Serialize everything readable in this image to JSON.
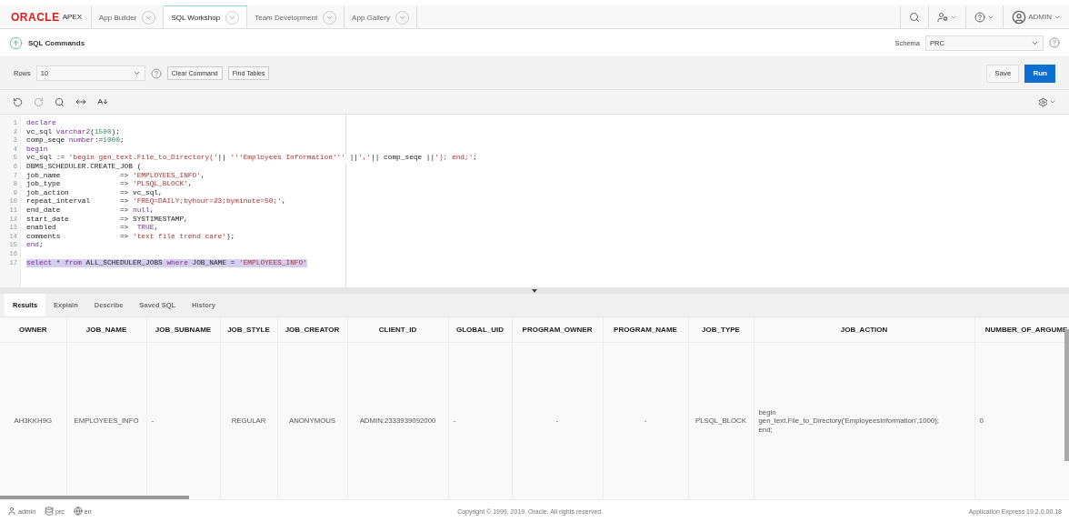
{
  "header": {
    "logo_brand": "ORACLE",
    "logo_product": "APEX",
    "user": "ADMIN",
    "tabs": [
      {
        "label": "App Builder",
        "selected": false
      },
      {
        "label": "SQL Workshop",
        "selected": true
      },
      {
        "label": "Team Development",
        "selected": false
      },
      {
        "label": "App Gallery",
        "selected": false
      }
    ]
  },
  "page": {
    "title": "SQL Commands",
    "schema_label": "Schema",
    "schema_value": "PRC"
  },
  "toolbar": {
    "rows_label": "Rows",
    "rows_value": "10",
    "buttons": [
      "Clear Command",
      "Find Tables"
    ],
    "save": "Save",
    "run": "Run"
  },
  "editor": {
    "lines": [
      {
        "number": "1",
        "selected": false,
        "tokens": [
          {
            "t": "declare",
            "kind": "kw"
          }
        ]
      },
      {
        "number": "2",
        "selected": false,
        "tokens": [
          {
            "t": "vc_sql ",
            "kind": "plain"
          },
          {
            "t": "varchar2",
            "kind": "kw"
          },
          {
            "t": "(",
            "kind": "plain"
          },
          {
            "t": "1500",
            "kind": "num"
          },
          {
            "t": ");",
            "kind": "plain"
          }
        ]
      },
      {
        "number": "3",
        "selected": false,
        "tokens": [
          {
            "t": "comp_seqe ",
            "kind": "plain"
          },
          {
            "t": "number",
            "kind": "kw"
          },
          {
            "t": ":=",
            "kind": "plain"
          },
          {
            "t": "1000",
            "kind": "num"
          },
          {
            "t": ";",
            "kind": "plain"
          }
        ]
      },
      {
        "number": "4",
        "selected": false,
        "tokens": [
          {
            "t": "begin",
            "kind": "kw"
          }
        ]
      },
      {
        "number": "5",
        "selected": false,
        "tokens": [
          {
            "t": "vc_sql := ",
            "kind": "plain"
          },
          {
            "t": "'begin gen_text.File_to_Directory('",
            "kind": "str"
          },
          {
            "t": "|| ",
            "kind": "plain"
          },
          {
            "t": "'''Employees Information'''",
            "kind": "str"
          },
          {
            "t": " ||",
            "kind": "plain"
          },
          {
            "t": "','",
            "kind": "str"
          },
          {
            "t": "|| comp_seqe ||",
            "kind": "plain"
          },
          {
            "t": "'); end;'",
            "kind": "str"
          },
          {
            "t": ";",
            "kind": "plain"
          }
        ]
      },
      {
        "number": "6",
        "selected": false,
        "tokens": [
          {
            "t": "DBMS_SCHEDULER.CREATE_JOB (",
            "kind": "plain"
          }
        ]
      },
      {
        "number": "7",
        "selected": false,
        "tokens": [
          {
            "t": "job_name              => ",
            "kind": "plain"
          },
          {
            "t": "'EMPLOYEES_INFO'",
            "kind": "str"
          },
          {
            "t": ",",
            "kind": "plain"
          }
        ]
      },
      {
        "number": "8",
        "selected": false,
        "tokens": [
          {
            "t": "job_type              => ",
            "kind": "plain"
          },
          {
            "t": "'PLSQL_BLOCK'",
            "kind": "str"
          },
          {
            "t": ",",
            "kind": "plain"
          }
        ]
      },
      {
        "number": "9",
        "selected": false,
        "tokens": [
          {
            "t": "job_action            => vc_sql,",
            "kind": "plain"
          }
        ]
      },
      {
        "number": "10",
        "selected": false,
        "tokens": [
          {
            "t": "repeat_interval       => ",
            "kind": "plain"
          },
          {
            "t": "'FREQ=DAILY;byhour=23;byminute=50;'",
            "kind": "str"
          },
          {
            "t": ",",
            "kind": "plain"
          }
        ]
      },
      {
        "number": "11",
        "selected": false,
        "tokens": [
          {
            "t": "end_date              => ",
            "kind": "plain"
          },
          {
            "t": "null",
            "kind": "kw"
          },
          {
            "t": ",",
            "kind": "plain"
          }
        ]
      },
      {
        "number": "12",
        "selected": false,
        "tokens": [
          {
            "t": "start_date            => SYSTIMESTAMP,",
            "kind": "plain"
          }
        ]
      },
      {
        "number": "13",
        "selected": false,
        "tokens": [
          {
            "t": "enabled               =>  ",
            "kind": "plain"
          },
          {
            "t": "TRUE",
            "kind": "kw"
          },
          {
            "t": ",",
            "kind": "plain"
          }
        ]
      },
      {
        "number": "14",
        "selected": false,
        "tokens": [
          {
            "t": "comments              => ",
            "kind": "plain"
          },
          {
            "t": "'text file trend care'",
            "kind": "str"
          },
          {
            "t": ");",
            "kind": "plain"
          }
        ]
      },
      {
        "number": "15",
        "selected": false,
        "tokens": [
          {
            "t": "end",
            "kind": "kw"
          },
          {
            "t": ";",
            "kind": "plain"
          }
        ]
      },
      {
        "number": "16",
        "selected": false
      },
      {
        "number": "17",
        "selected": true,
        "tokens": [
          {
            "t": "select",
            "kind": "kw"
          },
          {
            "t": " * ",
            "kind": "plain"
          },
          {
            "t": "from",
            "kind": "kw"
          },
          {
            "t": " ALL_SCHEDULER_JOBS ",
            "kind": "plain"
          },
          {
            "t": "where",
            "kind": "kw"
          },
          {
            "t": " JOB_NAME = ",
            "kind": "plain"
          },
          {
            "t": "'EMPLOYEES_INFO'",
            "kind": "str"
          }
        ]
      }
    ]
  },
  "result_tabs": [
    {
      "label": "Results",
      "selected": true
    },
    {
      "label": "Explain",
      "selected": false
    },
    {
      "label": "Describe",
      "selected": false
    },
    {
      "label": "Saved SQL",
      "selected": false
    },
    {
      "label": "History",
      "selected": false
    }
  ],
  "table": {
    "columns": [
      "OWNER",
      "JOB_NAME",
      "JOB_SUBNAME",
      "JOB_STYLE",
      "JOB_CREATOR",
      "CLIENT_ID",
      "GLOBAL_UID",
      "PROGRAM_OWNER",
      "PROGRAM_NAME",
      "JOB_TYPE",
      "JOB_ACTION",
      "NUMBER_OF_ARGUME"
    ],
    "rows": [
      [
        "AH3KKH9G",
        "EMPLOYEES_INFO",
        "-",
        "REGULAR",
        "ANONYMOUS",
        "ADMIN:2333939092000",
        "-",
        "-",
        "-",
        "PLSQL_BLOCK",
        "begin\ngen_text.File_to_Directory('EmployeesInformation',1000);\nend;",
        "0"
      ]
    ]
  },
  "status_bar": {
    "user": "admin",
    "schema": "prc",
    "language": "en",
    "copyright": "Copyright © 1999, 2019, Oracle. All rights reserved.",
    "version": "Application Express 19.2.0.00.18"
  }
}
